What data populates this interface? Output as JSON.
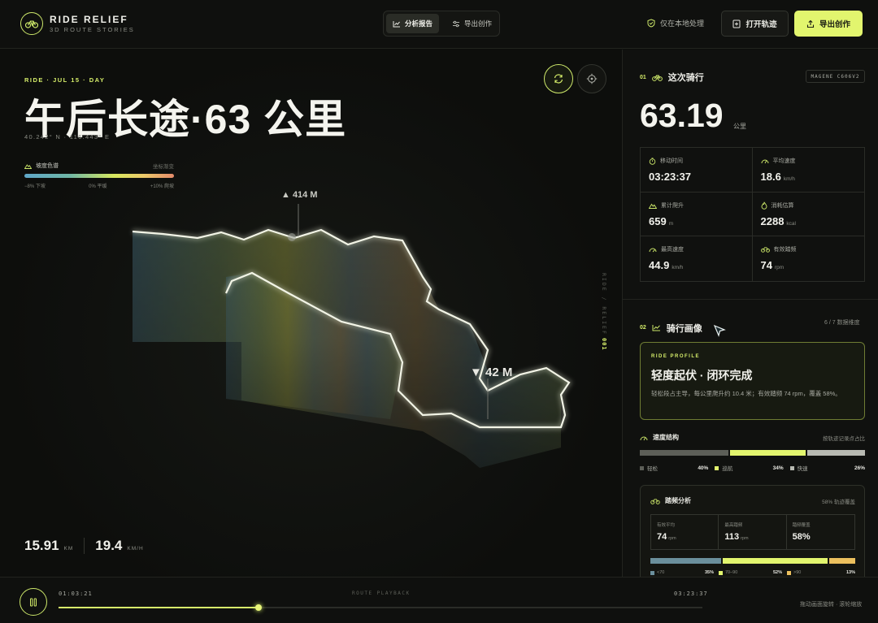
{
  "brand": {
    "title": "RIDE RELIEF",
    "subtitle": "3D ROUTE STORIES"
  },
  "tabs": [
    {
      "label": "分析报告",
      "icon": "chart-line-icon",
      "active": true
    },
    {
      "label": "导出创作",
      "icon": "sliders-icon",
      "active": false
    }
  ],
  "header": {
    "local_note": "仅在本地处理",
    "open_label": "打开轨迹",
    "export_label": "导出创作",
    "accent": "#e2f56e"
  },
  "map": {
    "ride_tag": "RIDE · JUL 15 · DAY",
    "title": "午后长途·63 公里",
    "coords": "40.242° N · 116.443° E",
    "legend": {
      "title": "坡度色谱",
      "right": "坐标渐变",
      "ticks": [
        "−8% 下坡",
        "0% 平缓",
        "+10% 爬坡"
      ]
    },
    "alt_high": "▲ 414 M",
    "alt_low": "▼ 42 M",
    "side_text": "RIDE / RELIEF",
    "side_num": "001",
    "distance": "15.91",
    "distance_unit": "KM",
    "speed": "19.4",
    "speed_unit": "KM/H"
  },
  "ride": {
    "num": "01",
    "title": "这次骑行",
    "device": "MAGENE C606V2",
    "distance": "63.19",
    "distance_unit": "公里",
    "stats": [
      {
        "label": "移动时间",
        "icon": "stopwatch-icon",
        "value": "03:23:37",
        "unit": ""
      },
      {
        "label": "平均速度",
        "icon": "gauge-icon",
        "value": "18.6",
        "unit": "km/h"
      },
      {
        "label": "累计爬升",
        "icon": "mountain-icon",
        "value": "659",
        "unit": "m"
      },
      {
        "label": "消耗估算",
        "icon": "flame-icon",
        "value": "2288",
        "unit": "kcal"
      },
      {
        "label": "最高速度",
        "icon": "speedometer-icon",
        "value": "44.9",
        "unit": "km/h"
      },
      {
        "label": "有效踏频",
        "icon": "bike-icon",
        "value": "74",
        "unit": "rpm"
      }
    ]
  },
  "portrait": {
    "num": "02",
    "title": "骑行画像",
    "dims": "6 / 7 数据维度",
    "card_tag": "RIDE PROFILE",
    "card_title": "轻度起伏 · 闭环完成",
    "card_desc": "轻松段占主导，每公里爬升约 10.4 米；有效踏频 74 rpm，覆盖 58%。"
  },
  "speed_structure": {
    "title": "速度结构",
    "right": "按轨迹记录点占比",
    "segments": [
      {
        "label": "轻松",
        "pct": "40%",
        "value": 40,
        "color": "#5d5f58"
      },
      {
        "label": "巡航",
        "pct": "34%",
        "value": 34,
        "color": "#e2f56e"
      },
      {
        "label": "快速",
        "pct": "26%",
        "value": 26,
        "color": "#b8bab2"
      }
    ]
  },
  "cadence": {
    "title": "踏频分析",
    "right": "58% 轨迹覆盖",
    "stats": [
      {
        "label": "有效平均",
        "value": "74",
        "unit": "rpm"
      },
      {
        "label": "最高踏频",
        "value": "113",
        "unit": "rpm"
      },
      {
        "label": "踏频覆盖",
        "value": "58%",
        "unit": ""
      }
    ],
    "segments": [
      {
        "label": "<70",
        "pct": "35%",
        "value": 35,
        "color": "#6b8f9c"
      },
      {
        "label": "70–90",
        "pct": "52%",
        "value": 52,
        "color": "#e2f56e"
      },
      {
        "label": ">90",
        "pct": "13%",
        "value": 13,
        "color": "#ecc05e"
      }
    ]
  },
  "playback": {
    "current": "01:03:21",
    "label": "ROUTE PLAYBACK",
    "total": "03:23:37",
    "progress": 0.31,
    "hint": "拖动画面旋转 · 滚轮缩放"
  }
}
